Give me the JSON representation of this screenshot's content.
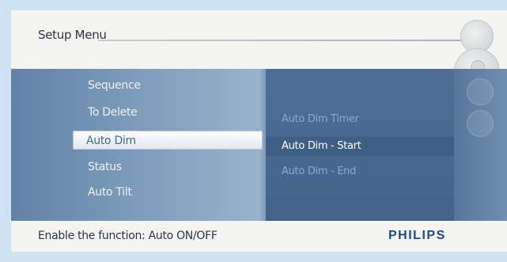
{
  "header": {
    "title": "Setup Menu"
  },
  "menu": {
    "items": [
      {
        "label": "Sequence"
      },
      {
        "label": "To Delete"
      },
      {
        "label": "Auto Dim",
        "selected": true
      },
      {
        "label": "Status"
      },
      {
        "label": "Auto Tilt"
      }
    ]
  },
  "submenu": {
    "items": [
      {
        "label": "Auto Dim Timer"
      },
      {
        "label": "Auto Dim - Start",
        "selected": true
      },
      {
        "label": "Auto Dim - End"
      }
    ]
  },
  "footer": {
    "help_text": "Enable the function: Auto ON/OFF",
    "brand": "PHILIPS"
  },
  "colors": {
    "background": "#cfe2f2",
    "panel": "#5f82a6",
    "brand": "#1c4a8a"
  }
}
